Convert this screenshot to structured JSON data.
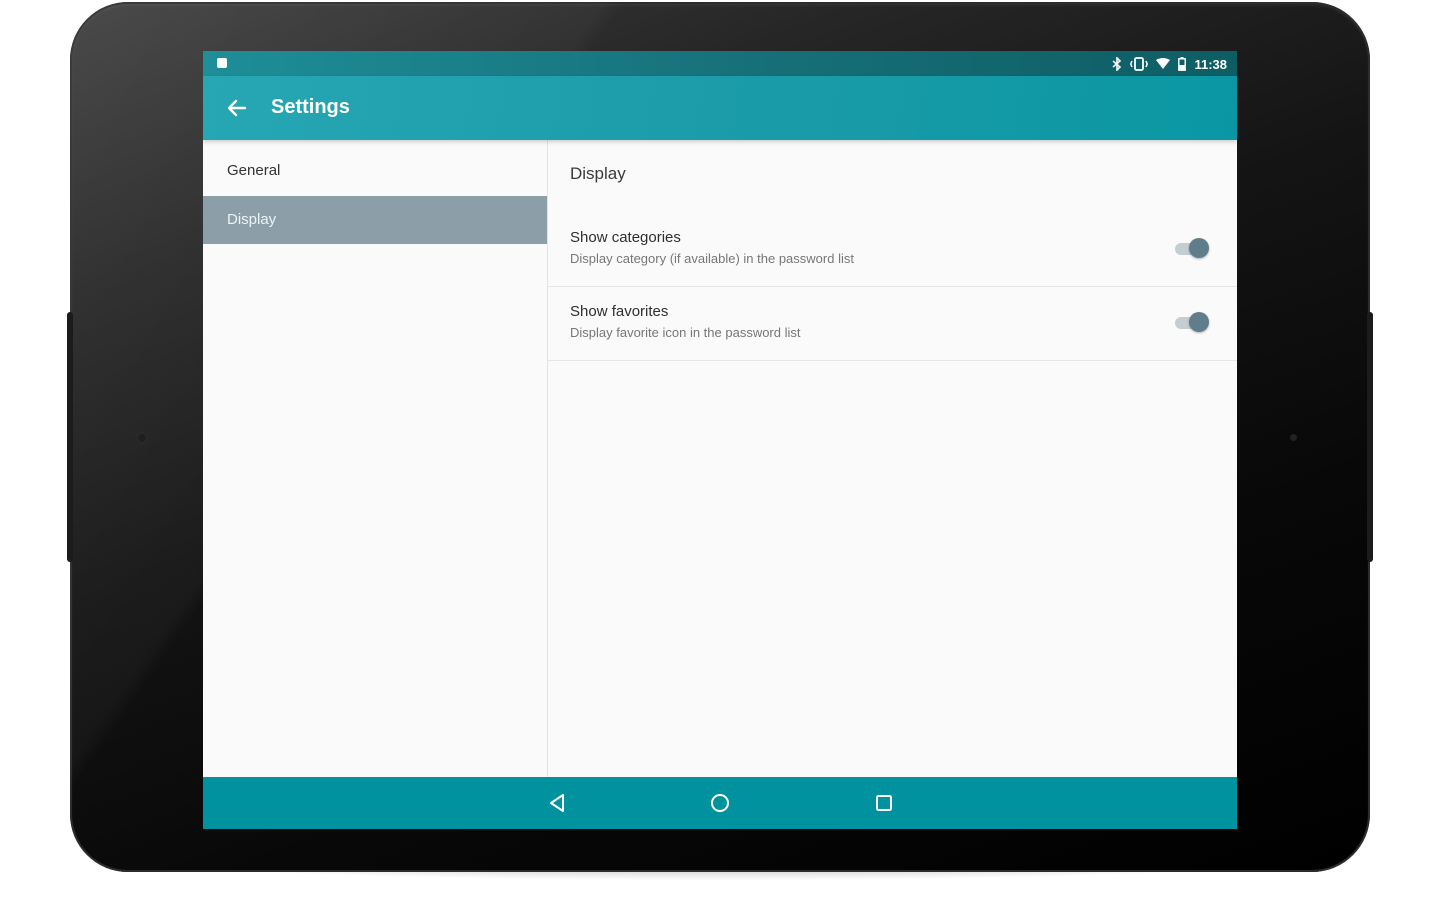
{
  "status_bar": {
    "time": "11:38",
    "icons": [
      "notification-icon",
      "bluetooth-icon",
      "vibrate-icon",
      "wifi-icon",
      "battery-icon"
    ]
  },
  "app_bar": {
    "title": "Settings",
    "back_icon": "arrow-back-icon",
    "color": "#1d9da9"
  },
  "headers": [
    {
      "label": "General",
      "selected": false
    },
    {
      "label": "Display",
      "selected": true
    }
  ],
  "display_settings": {
    "category_title": "Display",
    "preferences": [
      {
        "title": "Show categories",
        "summary": "Display category (if available) in the password list",
        "enabled": true
      },
      {
        "title": "Show favorites",
        "summary": "Display favorite icon in the password list",
        "enabled": true
      }
    ]
  },
  "nav_bar": {
    "buttons": [
      "back-icon",
      "home-icon",
      "recents-icon"
    ],
    "color": "#00939f"
  },
  "colors": {
    "selected_header_bg": "#8c9ea8",
    "switch_thumb": "#607d8b"
  }
}
